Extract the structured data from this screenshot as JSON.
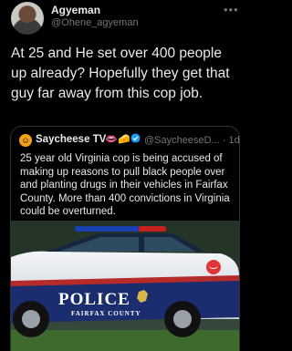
{
  "author": {
    "name": "Agyeman",
    "handle": "@Ohene_agyeman",
    "more_icon": "more-horizontal-icon"
  },
  "tweet": {
    "text": "At 25 and He set over 400 people up already? Hopefully they get that guy far away from this cop job."
  },
  "quoted": {
    "name": "Saycheese TV",
    "handle": "@SaycheeseD...",
    "separator": "·",
    "time": "1d",
    "text": "25 year old Virginia cop is being accused of making up reasons to pull black people over and planting drugs in their vehicles in Fairfax County. More than 400 convictions in Virginia could be overturned.",
    "image": {
      "text_police": "POLICE",
      "text_county": "FAIRFAX COUNTY"
    }
  },
  "colors": {
    "background": "#000000",
    "text": "#e7e9ea",
    "muted": "#71767b",
    "border": "#2f3336"
  }
}
